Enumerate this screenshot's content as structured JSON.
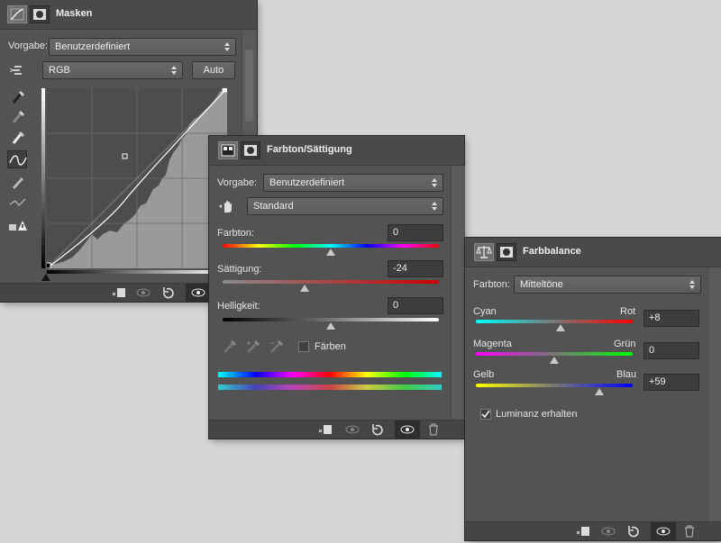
{
  "masken": {
    "title": "Masken",
    "vorgabe_label": "Vorgabe:",
    "vorgabe_value": "Benutzerdefiniert",
    "channel_value": "RGB",
    "auto_label": "Auto",
    "curve_points": [
      [
        0,
        0
      ],
      [
        86,
        75
      ],
      [
        199,
        199
      ]
    ]
  },
  "farbton": {
    "title": "Farbton/Sättigung",
    "vorgabe_label": "Vorgabe:",
    "vorgabe_value": "Benutzerdefiniert",
    "range_value": "Standard",
    "hue_label": "Farbton:",
    "hue_value": "0",
    "hue_level": 0.5,
    "sat_label": "Sättigung:",
    "sat_value": "-24",
    "sat_level": 0.38,
    "light_label": "Helligkeit:",
    "light_value": "0",
    "light_level": 0.5,
    "colorize_label": "Färben"
  },
  "farbbalance": {
    "title": "Farbbalance",
    "tone_label": "Farbton:",
    "tone_value": "Mitteltöne",
    "rows": [
      {
        "left": "Cyan",
        "right": "Rot",
        "value": "+8",
        "level": 0.54
      },
      {
        "left": "Magenta",
        "right": "Grün",
        "value": "0",
        "level": 0.5
      },
      {
        "left": "Gelb",
        "right": "Blau",
        "value": "+59",
        "level": 0.79
      }
    ],
    "luminance_label": "Luminanz erhalten",
    "luminance_checked": true
  },
  "colors": {
    "panel_bg": "#535353",
    "canvas_bg": "#d6d6d6",
    "curve_area": "#4d4d4d",
    "histogram": "#9a9a9a"
  }
}
